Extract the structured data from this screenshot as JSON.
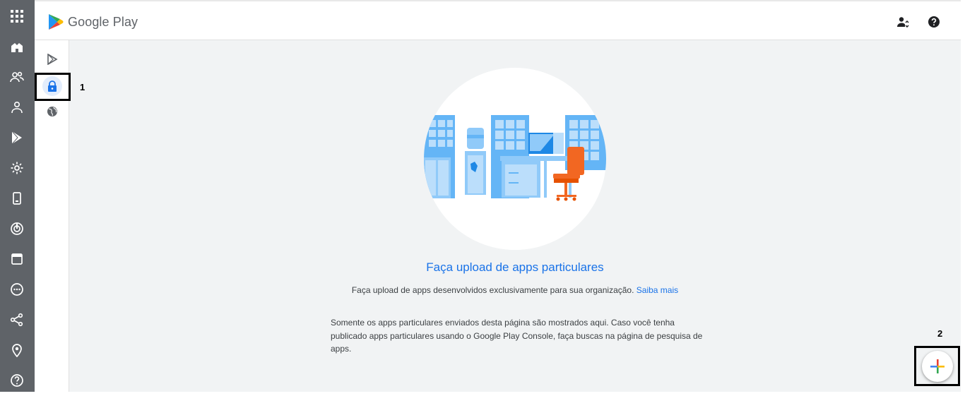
{
  "header": {
    "brand_name": "Google Play",
    "icons": [
      "manage-account-icon",
      "help-icon"
    ]
  },
  "rail": {
    "icons": [
      "apps-grid-icon",
      "dashboard-icon",
      "groups-icon",
      "user-icon",
      "play-icon",
      "settings-icon",
      "device-icon",
      "security-icon",
      "calendar-icon",
      "support-icon",
      "share-icon",
      "location-icon",
      "help-circle-icon"
    ]
  },
  "subnav": {
    "items": [
      {
        "icon": "play-store-icon",
        "active": false
      },
      {
        "icon": "lock-icon",
        "active": true
      },
      {
        "icon": "globe-icon",
        "active": false
      }
    ]
  },
  "main": {
    "title": "Faça upload de apps particulares",
    "subtitle": "Faça upload de apps desenvolvidos exclusivamente para sua organização.",
    "subtitle_link": "Saiba mais",
    "note": "Somente os apps particulares enviados desta página são mostrados aqui. Caso você tenha publicado apps particulares usando o Google Play Console, faça buscas na página de pesquisa de apps."
  },
  "annotations": {
    "label_1": "1",
    "label_2": "2"
  },
  "colors": {
    "accent": "#1a73e8",
    "rail": "#5f6368",
    "background": "#f1f3f4",
    "chair": "#f26722"
  }
}
